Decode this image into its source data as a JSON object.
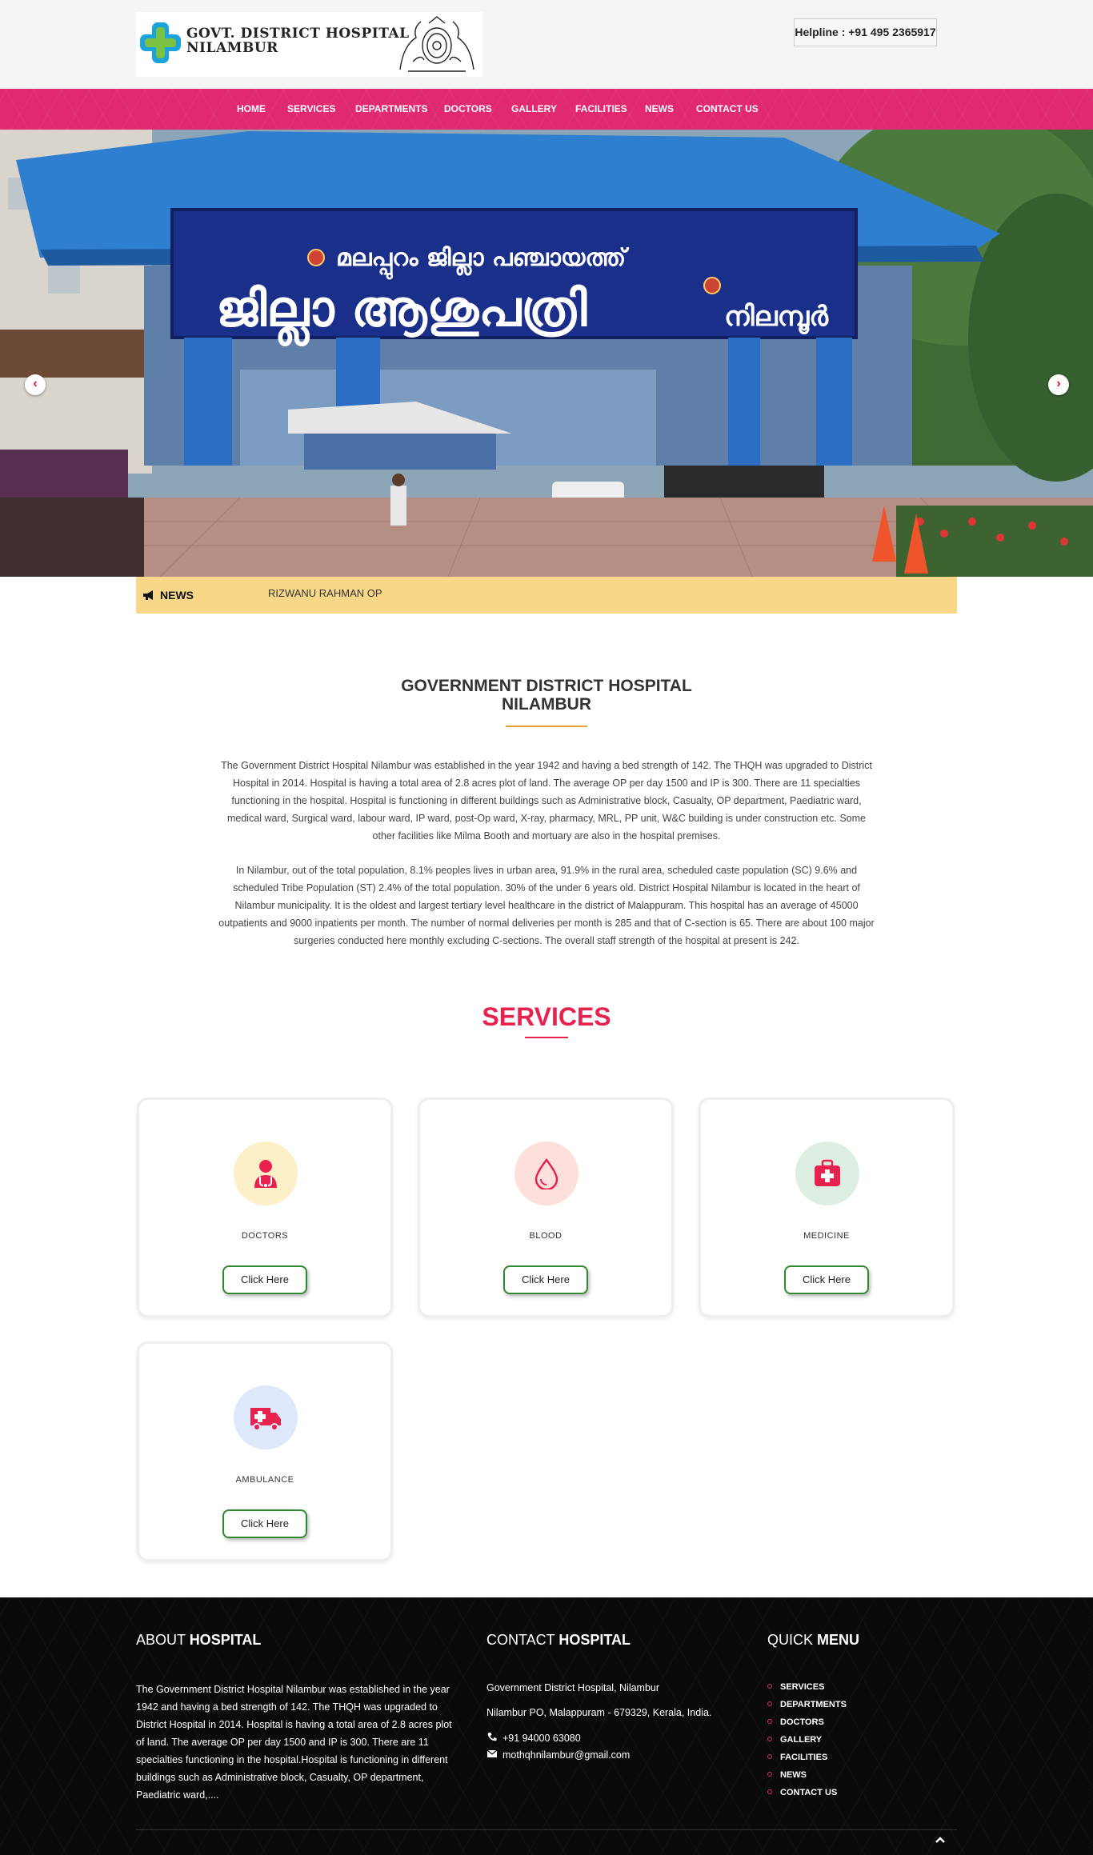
{
  "header": {
    "logo_line1": "GOVT. DISTRICT HOSPITAL",
    "logo_line2": "NILAMBUR",
    "helpline": "Helpline : +91 495 2365917"
  },
  "nav": {
    "items": [
      "HOME",
      "SERVICES",
      "DEPARTMENTS",
      "DOCTORS",
      "GALLERY",
      "FACILITIES",
      "NEWS",
      "CONTACT US"
    ]
  },
  "hero": {
    "sign_line1": "മലപ്പുറം ജില്ലാ പഞ്ചായത്ത്",
    "sign_line2": "ജില്ലാ ആശുപത്രി",
    "sign_line3": "നിലമ്പൂർ",
    "prev_icon": "chevron-left-icon",
    "next_icon": "chevron-right-icon"
  },
  "news": {
    "label": "NEWS",
    "ticker": "RIZWANU RAHMAN OP"
  },
  "about": {
    "title_line1": "GOVERNMENT DISTRICT HOSPITAL",
    "title_line2": "NILAMBUR",
    "para1": "The Government District Hospital Nilambur was established in the year 1942 and having a bed strength of 142. The THQH was upgraded to District Hospital in 2014. Hospital is having a total area of 2.8 acres plot of land. The average OP per day 1500 and IP is 300. There are 11 specialties functioning in the hospital. Hospital is functioning in different buildings such as Administrative block, Casualty, OP department, Paediatric ward, medical ward, Surgical ward, labour ward, IP ward, post-Op ward, X-ray, pharmacy, MRL, PP unit, W&C building is under construction etc. Some other facilities like Milma Booth and mortuary are also in the hospital premises.",
    "para2": "In Nilambur, out of the total population, 8.1% peoples lives in urban area, 91.9% in the rural area, scheduled caste population (SC) 9.6% and scheduled Tribe Population (ST) 2.4% of the total population. 30% of the under 6 years old. District Hospital Nilambur is located in the heart of Nilambur municipality. It is the oldest and largest tertiary level healthcare in the district of Malappuram. This hospital has an average of 45000 outpatients and 9000 inpatients per month. The number of normal deliveries per month is 285 and that of C-section is 65. There are about 100 major surgeries conducted here monthly excluding C-sections. The overall staff strength of the hospital at present is 242."
  },
  "services": {
    "title": "SERVICES",
    "cards": [
      {
        "label": "DOCTORS",
        "button": "Click Here",
        "icon": "doctor-icon",
        "bg": "#fdf0c8"
      },
      {
        "label": "BLOOD",
        "button": "Click Here",
        "icon": "blood-drop-icon",
        "bg": "#fde0dc"
      },
      {
        "label": "MEDICINE",
        "button": "Click Here",
        "icon": "medical-kit-icon",
        "bg": "#dcefe2"
      },
      {
        "label": "AMBULANCE",
        "button": "Click Here",
        "icon": "ambulance-icon",
        "bg": "#dde8fb"
      }
    ]
  },
  "footer": {
    "about_head_light": "ABOUT ",
    "about_head_bold": "HOSPITAL",
    "about_text": "The Government District Hospital Nilambur was established in the year 1942 and having a bed strength of 142. The THQH was upgraded to District Hospital in 2014. Hospital is having a total area of 2.8 acres plot of land. The average OP per day 1500 and IP is 300. There are 11 specialties functioning in the hospital.Hospital is functioning in different buildings such as Administrative block, Casualty, OP department, Paediatric ward,....",
    "contact_head_light": "CONTACT ",
    "contact_head_bold": "HOSPITAL",
    "contact_name": "Government District Hospital, Nilambur",
    "contact_address": "Nilambur PO, Malappuram - 679329, Kerala, India.",
    "contact_phone": "+91 94000 63080",
    "contact_email": "mothqhnilambur@gmail.com",
    "quick_head_light": "QUICK ",
    "quick_head_bold": "MENU",
    "quick_links": [
      "SERVICES",
      "DEPARTMENTS",
      "DOCTORS",
      "GALLERY",
      "FACILITIES",
      "NEWS",
      "CONTACT US"
    ]
  },
  "colors": {
    "nav_pink": "#e0296f",
    "accent_red": "#e8224e",
    "news_bg": "#f8d888",
    "button_green": "#2f8a2f",
    "footer_bg": "#0a0a0a"
  }
}
